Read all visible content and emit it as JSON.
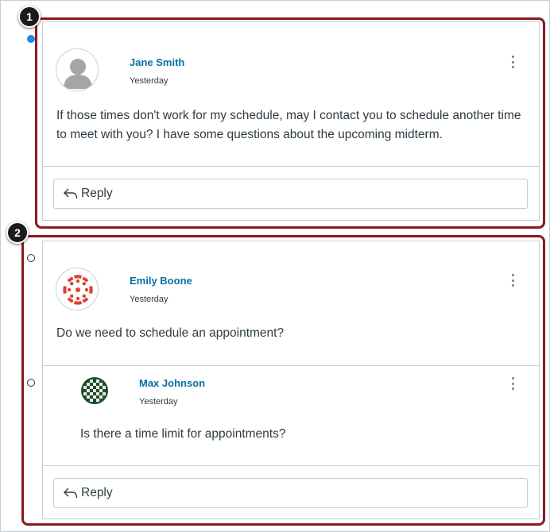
{
  "thread_1": {
    "callout_number": "1",
    "unread": true,
    "author": "Jane Smith",
    "timestamp": "Yesterday",
    "message": "If those times don't work for my schedule, may I contact you to schedule another time to meet with you? I have some questions about the upcoming midterm.",
    "reply_label": "Reply"
  },
  "thread_2": {
    "callout_number": "2",
    "unread": false,
    "author": "Emily Boone",
    "timestamp": "Yesterday",
    "message": "Do we need to schedule an appointment?",
    "nested_reply": {
      "unread": false,
      "author": "Max Johnson",
      "timestamp": "Yesterday",
      "message": "Is there a time limit for appointments?"
    },
    "reply_label": "Reply"
  },
  "colors": {
    "highlight": "#8b1a1a",
    "author_link": "#0770a3",
    "unread_dot": "#1e88e5",
    "canvas_logo": "#e0422f"
  }
}
